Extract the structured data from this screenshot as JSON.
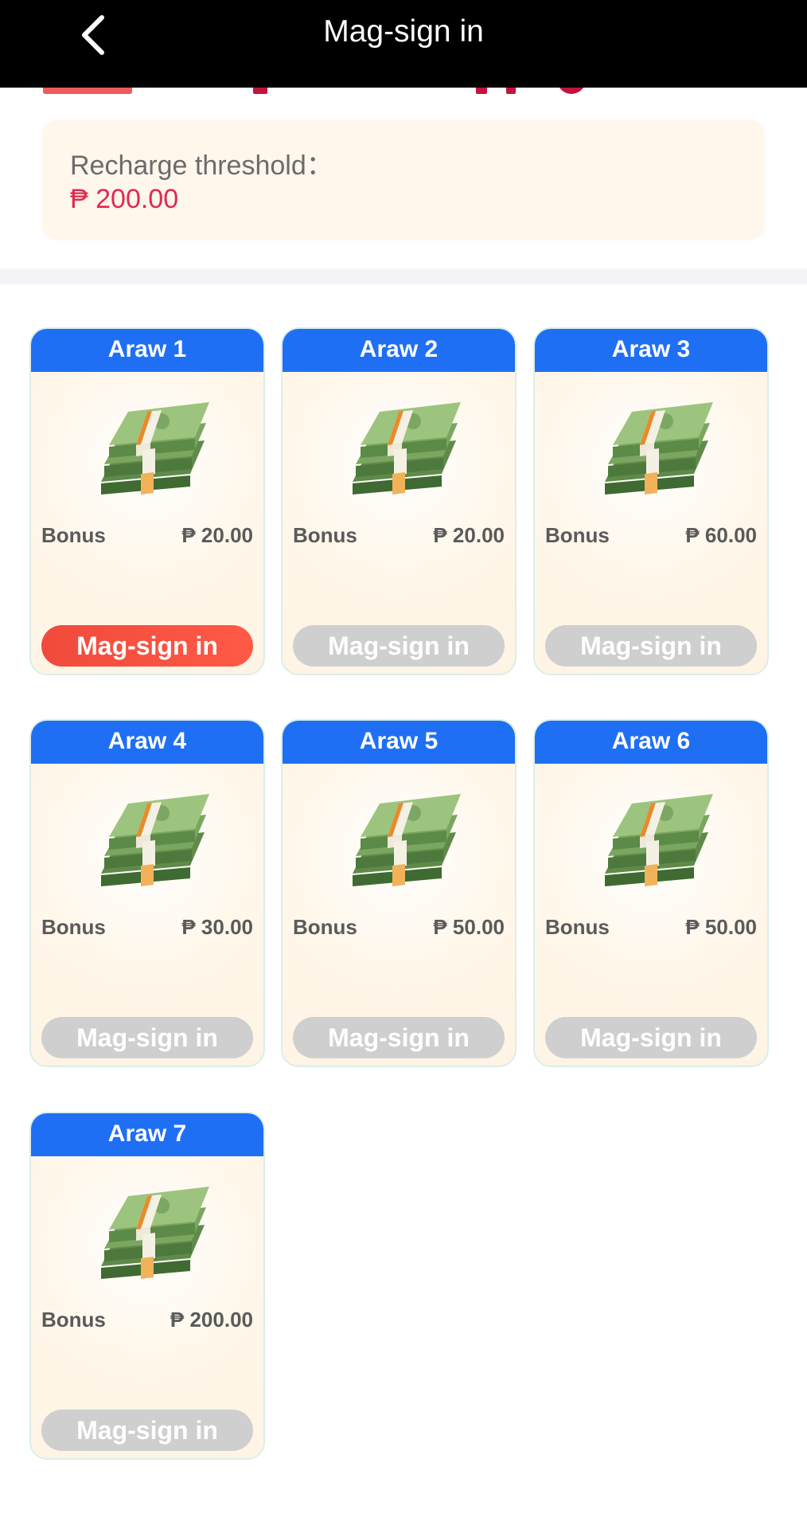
{
  "header": {
    "title": "Mag-sign in",
    "back_icon": "chevron-left-icon"
  },
  "threshold": {
    "label": "Recharge threshold：",
    "value": "₱ 200.00"
  },
  "colors": {
    "header_bg": "#000000",
    "card_header": "#1f6ff5",
    "active_button": "#f04a3c",
    "disabled_button": "#cfcfcf",
    "threshold_value": "#e02a4e"
  },
  "cards": [
    {
      "day": "Araw 1",
      "bonus_label": "Bonus",
      "bonus_value": "₱ 20.00",
      "button": "Mag-sign in",
      "active": true,
      "icon": "cash-stack-icon"
    },
    {
      "day": "Araw 2",
      "bonus_label": "Bonus",
      "bonus_value": "₱ 20.00",
      "button": "Mag-sign in",
      "active": false,
      "icon": "cash-stack-icon"
    },
    {
      "day": "Araw 3",
      "bonus_label": "Bonus",
      "bonus_value": "₱ 60.00",
      "button": "Mag-sign in",
      "active": false,
      "icon": "cash-stack-icon"
    },
    {
      "day": "Araw 4",
      "bonus_label": "Bonus",
      "bonus_value": "₱ 30.00",
      "button": "Mag-sign in",
      "active": false,
      "icon": "cash-stack-icon"
    },
    {
      "day": "Araw 5",
      "bonus_label": "Bonus",
      "bonus_value": "₱ 50.00",
      "button": "Mag-sign in",
      "active": false,
      "icon": "cash-stack-icon"
    },
    {
      "day": "Araw 6",
      "bonus_label": "Bonus",
      "bonus_value": "₱ 50.00",
      "button": "Mag-sign in",
      "active": false,
      "icon": "cash-stack-icon"
    },
    {
      "day": "Araw 7",
      "bonus_label": "Bonus",
      "bonus_value": "₱ 200.00",
      "button": "Mag-sign in",
      "active": false,
      "icon": "cash-stack-icon"
    }
  ]
}
